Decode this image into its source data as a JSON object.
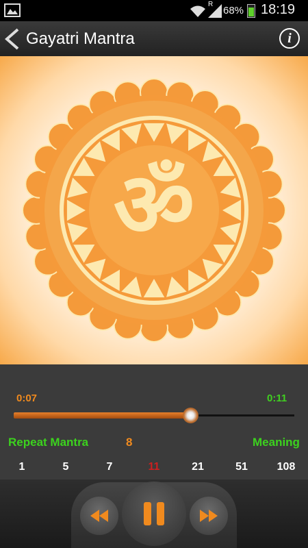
{
  "status_bar": {
    "battery_text": "68%",
    "time": "18:19",
    "roaming_indicator": "R"
  },
  "app_bar": {
    "title": "Gayatri Mantra"
  },
  "player": {
    "elapsed": "0:07",
    "total": "0:11",
    "progress": 0.63,
    "repeat_label": "Repeat Mantra",
    "repeat_count": "8",
    "meaning_label": "Meaning",
    "count_options": [
      "1",
      "5",
      "7",
      "11",
      "21",
      "51",
      "108"
    ],
    "selected_count": "11"
  },
  "colors": {
    "accent_orange": "#f08a1e",
    "accent_green": "#3cd21e",
    "selected_red": "#cc2020"
  },
  "icons": {
    "back": "chevron-left-icon",
    "info": "info-icon",
    "rewind": "rewind-icon",
    "pause": "pause-icon",
    "fast_forward": "fast-forward-icon"
  }
}
